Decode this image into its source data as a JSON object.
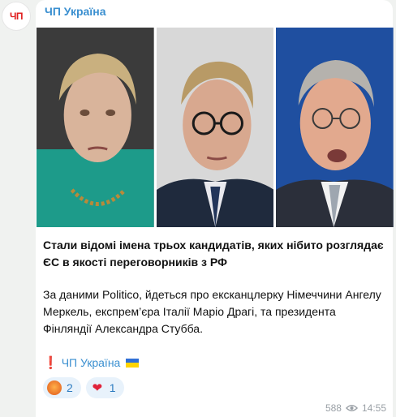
{
  "channel": {
    "avatar_text": "ЧП",
    "name": "ЧП Україна"
  },
  "post": {
    "title": "Стали відомі імена трьох кандидатів, яких нібито розглядає ЄС в якості переговорників з РФ",
    "body": "За даними Politico, йдеться про ексканцлерку Німеччини Ангелу Меркель, експрем’єра Італії Маріо Драгі, та президента Фінляндії Александра Стубба.",
    "signature": "ЧП Україна",
    "photos": [
      {
        "icon": "person-photo-1"
      },
      {
        "icon": "person-photo-2"
      },
      {
        "icon": "person-photo-3"
      }
    ]
  },
  "reactions": [
    {
      "icon": "angry-face-icon",
      "count": "2"
    },
    {
      "icon": "red-heart-icon",
      "count": "1"
    }
  ],
  "meta": {
    "views": "588",
    "time": "14:55"
  },
  "colors": {
    "link": "#3a8fd0",
    "background": "#f0f2f0",
    "reaction_bg": "#e8f2fb"
  }
}
